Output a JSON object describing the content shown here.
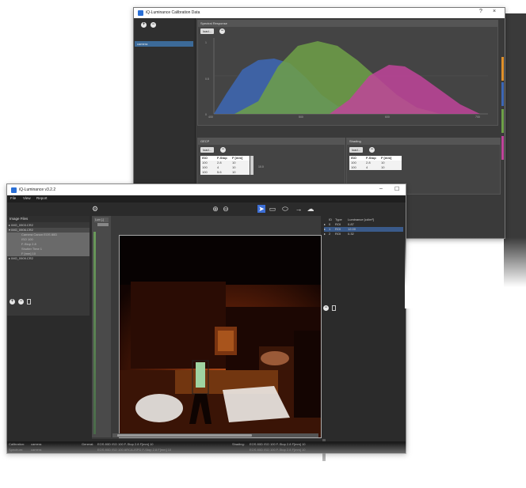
{
  "calibration_window": {
    "title": "iQ-Luminance Calibration Data",
    "help_label": "?",
    "close_label": "×",
    "sidebar_item": "camera",
    "spectral": {
      "header": "Spectral Response",
      "dropdown": "load...",
      "y_ticks": [
        "1",
        "0.5",
        "0"
      ],
      "x_ticks": [
        "400",
        "500",
        "600",
        "700"
      ]
    },
    "gecp": {
      "header": "GECP",
      "dropdown": "load...",
      "columns": [
        "ISO",
        "F-Stop",
        "F [mm]"
      ],
      "rows": [
        [
          "100",
          "2.8",
          "10"
        ],
        [
          "100",
          "4",
          "10"
        ],
        [
          "100",
          "5.6",
          "10"
        ]
      ],
      "side_label": "10.0"
    },
    "shading": {
      "header": "Shading",
      "dropdown": "load...",
      "columns": [
        "ISO",
        "F-Stop",
        "F [mm]"
      ],
      "rows": [
        [
          "100",
          "2.8",
          "10"
        ],
        [
          "100",
          "4",
          "10"
        ]
      ]
    },
    "colors": {
      "blue": "#3d67b5",
      "green": "#6ea048",
      "magenta": "#c0449a"
    }
  },
  "main_window": {
    "title": "iQ-Luminance v3.2.2",
    "minimize_label": "–",
    "maximize_label": "☐",
    "menu": [
      "File",
      "View",
      "Report"
    ],
    "image_files_header": "Image Files",
    "tree": [
      {
        "label": "▸ IMG_0903.CR2",
        "level": 0
      },
      {
        "label": "▾ IMG_0906.CR2",
        "level": 0
      },
      {
        "label": "Camera Canon EOS 80D",
        "level": 1
      },
      {
        "label": "ISO 100",
        "level": 1
      },
      {
        "label": "F-Stop 2.8",
        "level": 1
      },
      {
        "label": "Shutter Time 1",
        "level": 1
      },
      {
        "label": "F [mm] 10",
        "level": 1
      },
      {
        "label": "▸ IMG_0909.CR2",
        "level": 0
      }
    ],
    "viewer_tab": "Lum [-]",
    "results_table": {
      "columns": [
        "ID",
        "Type",
        "Luminance [cd/m²]"
      ],
      "rows": [
        [
          "0",
          "ROI",
          "0.87"
        ],
        [
          "1",
          "ROI",
          "12.00"
        ],
        [
          "2",
          "ROI",
          "0.32"
        ]
      ],
      "selected_row": 1
    },
    "status": {
      "row1": {
        "calibration_label": "Calibration:",
        "calibration_value": "camera",
        "general_label": "General:",
        "general_value": "EOS 80D ISO 100 F-Stop 2.8 F[mm] 10",
        "shading_label": "Shading:",
        "shading_value": "EOS 80D ISO 100 F-Stop 2.8 F[mm] 10"
      },
      "row2": {
        "spectrum_label": "Spectrum:",
        "spectrum_value": "camera",
        "general_value": "EOS 80D ISO 100 ARCA-ISPD F-Stop 2.8 F[mm] 10",
        "shading_value": "EOS 80D ISO 100 F-Stop 2.8 F[mm] 10"
      }
    }
  }
}
